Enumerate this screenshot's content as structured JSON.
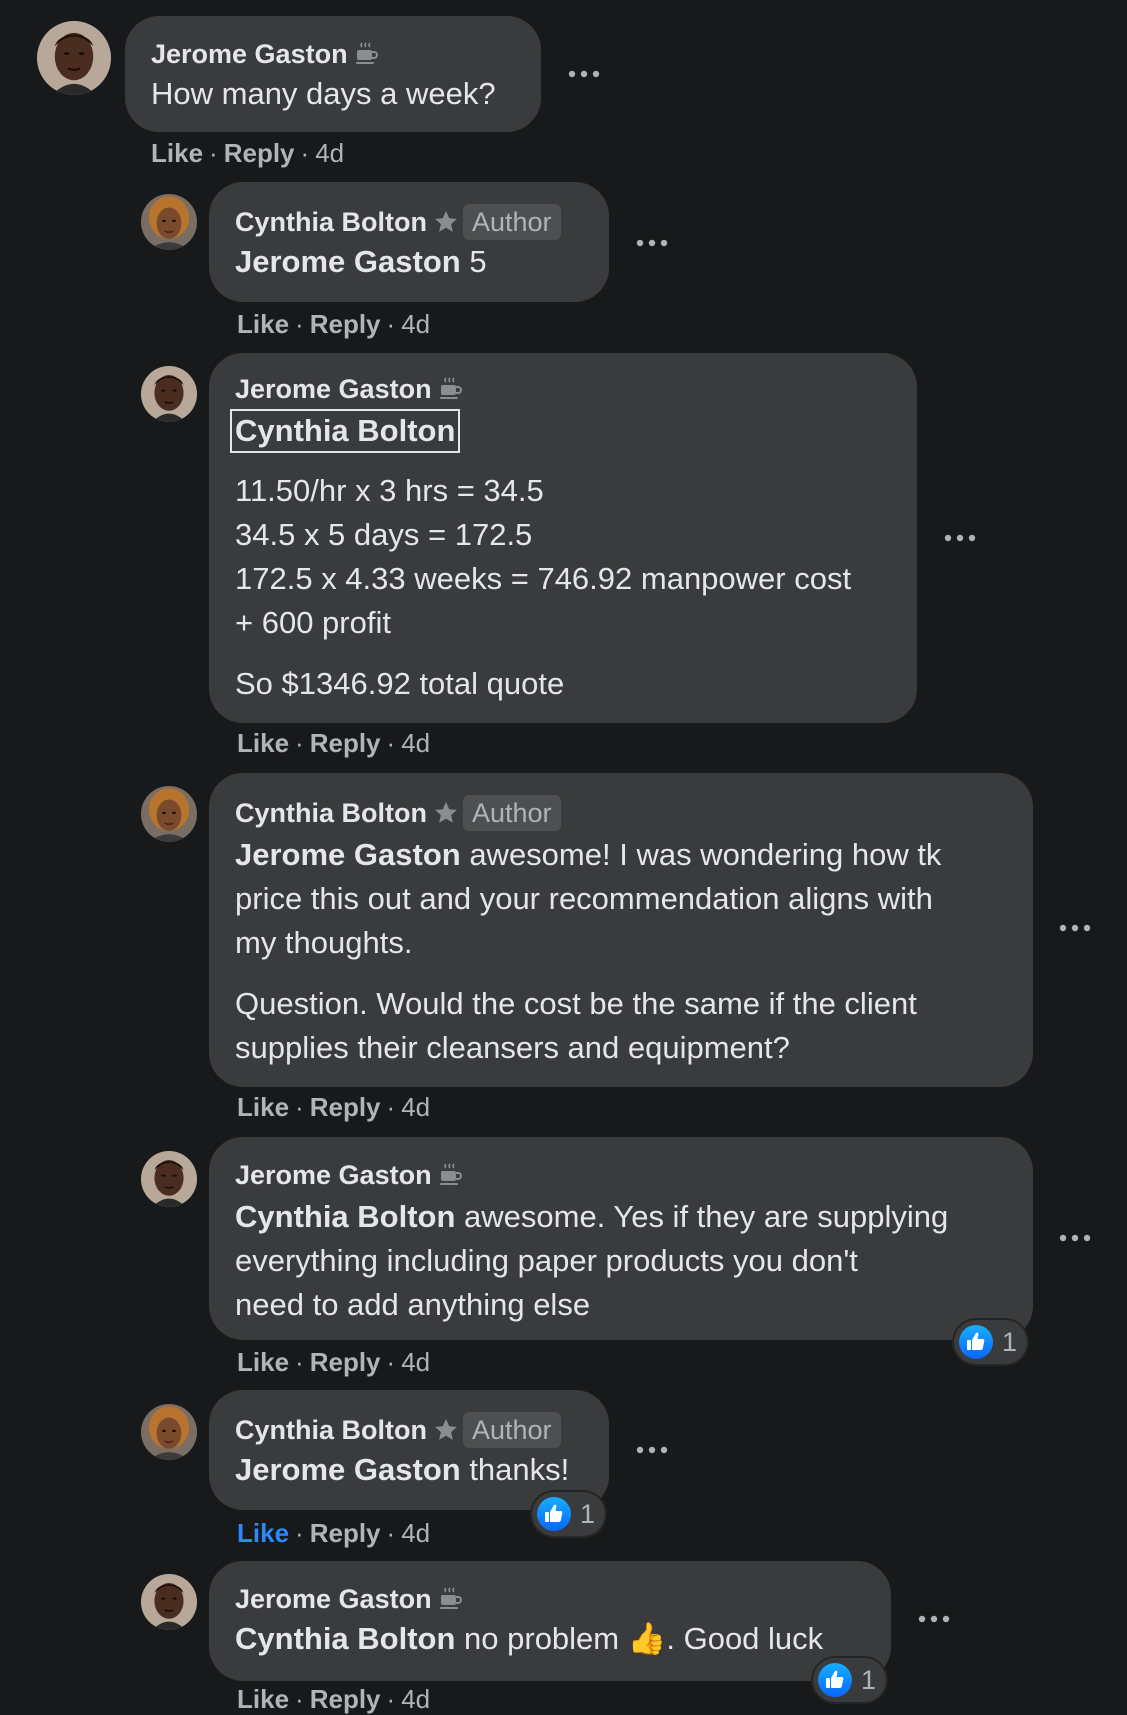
{
  "comments": [
    {
      "author": "Jerome Gaston",
      "badge_icon": "coffee-cup-icon",
      "text": "How many days a week?",
      "actions": {
        "like": "Like",
        "reply": "Reply",
        "time": "4d"
      }
    },
    {
      "author": "Cynthia Bolton",
      "badge_icon": "star-icon",
      "author_badge": "Author",
      "mention": "Jerome Gaston",
      "text": " 5",
      "actions": {
        "like": "Like",
        "reply": "Reply",
        "time": "4d"
      }
    },
    {
      "author": "Jerome Gaston",
      "badge_icon": "coffee-cup-icon",
      "mention": "Cynthia Bolton",
      "lines": [
        "11.50/hr x 3 hrs = 34.5",
        "34.5 x 5 days = 172.5",
        "172.5 x 4.33 weeks = 746.92 manpower cost",
        "+ 600 profit"
      ],
      "closing": "So $1346.92 total quote",
      "actions": {
        "like": "Like",
        "reply": "Reply",
        "time": "4d"
      }
    },
    {
      "author": "Cynthia Bolton",
      "badge_icon": "star-icon",
      "author_badge": "Author",
      "mention": "Jerome Gaston",
      "text_line1": " awesome! I was wondering how tk",
      "text_line2": "price this out and your recommendation aligns with",
      "text_line3": "my thoughts.",
      "para2_line1": "Question. Would the cost be the same if the client",
      "para2_line2": "supplies their cleansers and equipment?",
      "actions": {
        "like": "Like",
        "reply": "Reply",
        "time": "4d"
      }
    },
    {
      "author": "Jerome Gaston",
      "badge_icon": "coffee-cup-icon",
      "mention": "Cynthia Bolton",
      "text_line1": " awesome. Yes if they are supplying",
      "text_line2": "everything including paper products you don't",
      "text_line3": "need to add anything else",
      "reaction": {
        "icon": "like-reaction-icon",
        "count": "1"
      },
      "actions": {
        "like": "Like",
        "reply": "Reply",
        "time": "4d"
      }
    },
    {
      "author": "Cynthia Bolton",
      "badge_icon": "star-icon",
      "author_badge": "Author",
      "mention": "Jerome Gaston",
      "text": " thanks!",
      "reaction": {
        "icon": "like-reaction-icon",
        "count": "1"
      },
      "actions": {
        "like": "Like",
        "reply": "Reply",
        "time": "4d",
        "liked": true
      }
    },
    {
      "author": "Jerome Gaston",
      "badge_icon": "coffee-cup-icon",
      "mention": "Cynthia Bolton",
      "text": " no problem ",
      "emoji": "👍",
      "text_after": ". Good luck",
      "reaction": {
        "icon": "like-reaction-icon",
        "count": "1"
      },
      "actions": {
        "like": "Like",
        "reply": "Reply",
        "time": "4d"
      }
    }
  ],
  "colors": {
    "background": "#18191a",
    "bubble": "#3a3b3c",
    "text": "#e4e6eb",
    "secondary_text": "#b0b3b8",
    "liked_blue": "#2d88ff"
  }
}
